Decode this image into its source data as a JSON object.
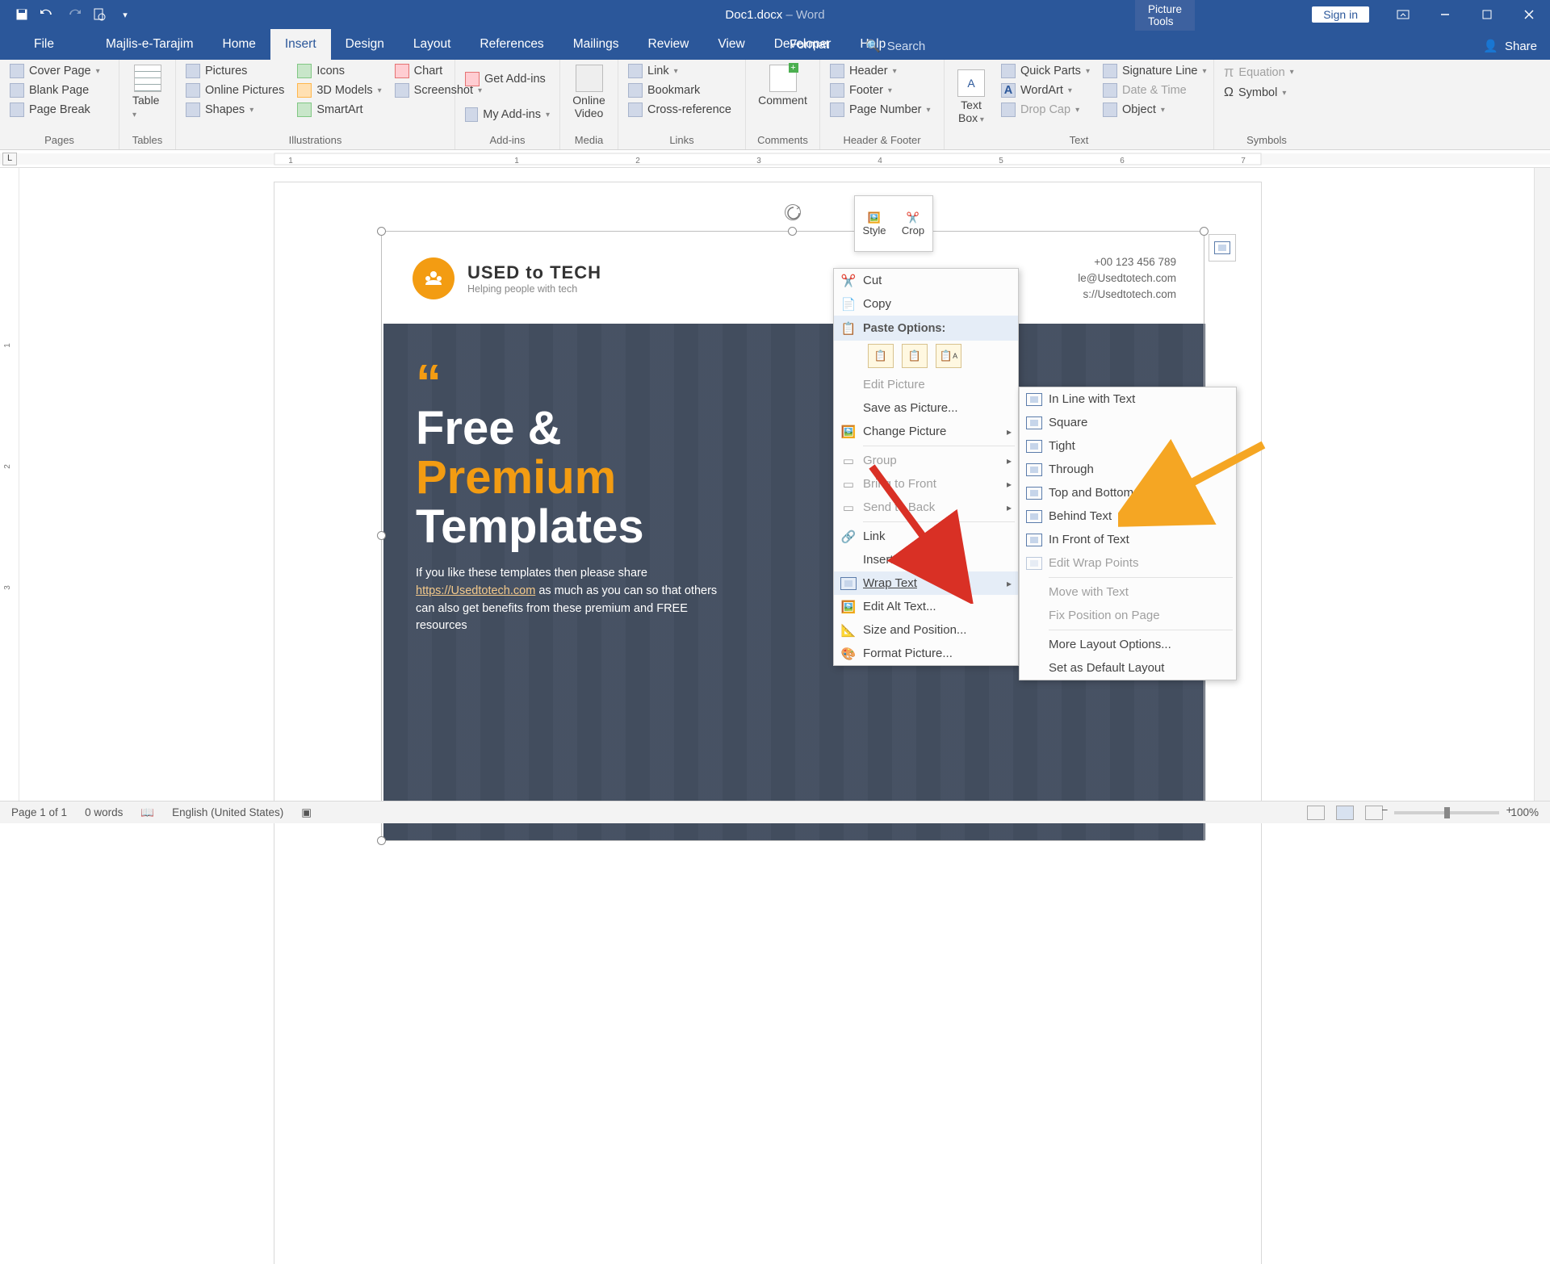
{
  "qat": {
    "save": "save",
    "undo": "undo",
    "redo": "redo",
    "preview": "print-preview",
    "custom": "customize"
  },
  "title": {
    "doc": "Doc1.docx",
    "sep": " – ",
    "app": "Word",
    "picture_tools": "Picture Tools",
    "sign_in": "Sign in"
  },
  "tabs": {
    "file": "File",
    "majlis": "Majlis-e-Tarajim",
    "home": "Home",
    "insert": "Insert",
    "design": "Design",
    "layout": "Layout",
    "references": "References",
    "mailings": "Mailings",
    "review": "Review",
    "view": "View",
    "developer": "Developer",
    "help": "Help",
    "format": "Format",
    "search": "Search",
    "share": "Share"
  },
  "ribbon": {
    "pages": {
      "label": "Pages",
      "cover": "Cover Page",
      "blank": "Blank Page",
      "break": "Page Break"
    },
    "tables": {
      "label": "Tables",
      "table": "Table"
    },
    "illus": {
      "label": "Illustrations",
      "pictures": "Pictures",
      "online_pictures": "Online Pictures",
      "shapes": "Shapes",
      "icons": "Icons",
      "models": "3D Models",
      "smartart": "SmartArt",
      "chart": "Chart",
      "screenshot": "Screenshot"
    },
    "addins": {
      "label": "Add-ins",
      "get": "Get Add-ins",
      "my": "My Add-ins"
    },
    "media": {
      "label": "Media",
      "video": "Online\nVideo"
    },
    "links": {
      "label": "Links",
      "link": "Link",
      "bookmark": "Bookmark",
      "cross": "Cross-reference"
    },
    "comments": {
      "label": "Comments",
      "comment": "Comment"
    },
    "hf": {
      "label": "Header & Footer",
      "header": "Header",
      "footer": "Footer",
      "pageno": "Page Number"
    },
    "text": {
      "label": "Text",
      "textbox": "Text\nBox",
      "quick": "Quick Parts",
      "wordart": "WordArt",
      "dropcap": "Drop Cap",
      "sig": "Signature Line",
      "date": "Date & Time",
      "object": "Object"
    },
    "symbols": {
      "label": "Symbols",
      "eq": "Equation",
      "sym": "Symbol"
    }
  },
  "mini_tb": {
    "style": "Style",
    "crop": "Crop"
  },
  "ctx": {
    "cut": "Cut",
    "copy": "Copy",
    "paste_hdr": "Paste Options:",
    "edit_pic": "Edit Picture",
    "save_as": "Save as Picture...",
    "change": "Change Picture",
    "group": "Group",
    "bring_front": "Bring to Front",
    "send_back": "Send to Back",
    "link": "Link",
    "caption": "Insert Caption...",
    "wrap": "Wrap Text",
    "alt": "Edit Alt Text...",
    "size": "Size and Position...",
    "format": "Format Picture..."
  },
  "wrap_sub": {
    "inline": "In Line with Text",
    "square": "Square",
    "tight": "Tight",
    "through": "Through",
    "topbot": "Top and Bottom",
    "behind": "Behind Text",
    "front": "In Front of Text",
    "edit_pts": "Edit Wrap Points",
    "move": "Move with Text",
    "fix": "Fix Position on Page",
    "more": "More Layout Options...",
    "default": "Set as Default Layout"
  },
  "template": {
    "brand": "USED to TECH",
    "tag": "Helping people with tech",
    "phone": "+00 123 456 789",
    "email": "le@Usedtotech.com",
    "url": "s://Usedtotech.com",
    "h1a": "Free &",
    "h1b": "Premium",
    "h1c": "Templates",
    "para_a": "If you like these templates then please share ",
    "para_link": "https://Usedtotech.com",
    "para_b": " as much as you can so that others can also get benefits from these premium and FREE resources"
  },
  "status": {
    "page": "Page 1 of 1",
    "words": "0 words",
    "lang": "English (United States)",
    "zoom": "100%"
  }
}
